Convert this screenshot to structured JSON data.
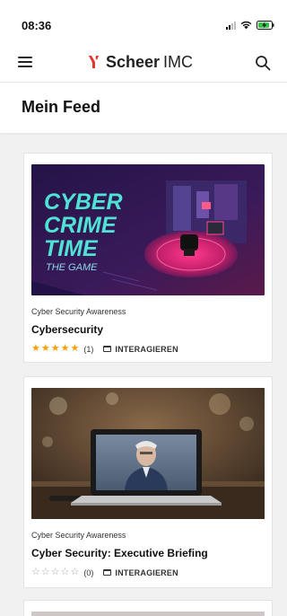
{
  "status_bar": {
    "time": "08:36"
  },
  "header": {
    "logo_mark": "ᛚᛚ",
    "brand": "Scheer",
    "brand_suffix": "IMC"
  },
  "page": {
    "title": "Mein Feed"
  },
  "feed": [
    {
      "category": "Cyber Security Awareness",
      "title": "Cybersecurity",
      "rating": 5,
      "rating_count": "(1)",
      "action_label": "INTERAGIEREN",
      "thumbnail": {
        "line1": "CYBER",
        "line2": "CRIME",
        "line3": "TIME",
        "subtitle": "THE GAME"
      }
    },
    {
      "category": "Cyber Security Awareness",
      "title": "Cyber Security: Executive Briefing",
      "rating": 0,
      "rating_count": "(0)",
      "action_label": "INTERAGIEREN"
    }
  ],
  "colors": {
    "accent": "#e8332a",
    "star": "#f3a10a",
    "game_cyan": "#4fe3d6",
    "game_bg": "#2a1648"
  }
}
